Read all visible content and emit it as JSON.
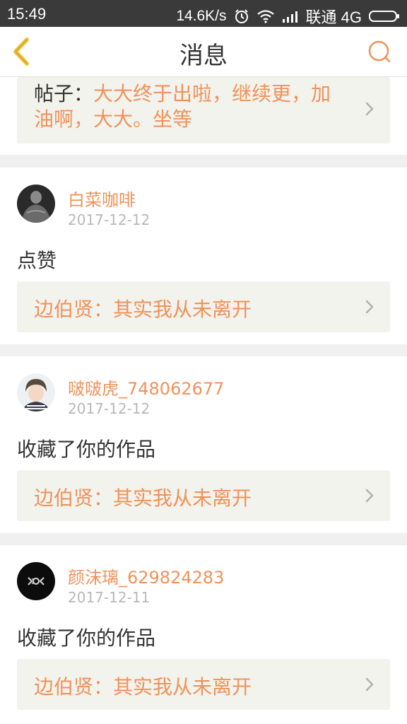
{
  "status": {
    "time": "15:49",
    "speed": "14.6K/s",
    "carrier": "联通 4G"
  },
  "header": {
    "title": "消息"
  },
  "top_post": {
    "label": "帖子：",
    "text": "大大终于出啦，继续更，加",
    "text_line2": "油啊，大大。坐等"
  },
  "messages": [
    {
      "user": "白菜咖啡",
      "date": "2017-12-12",
      "action": "点赞",
      "work": "边伯贤：其实我从未离开"
    },
    {
      "user": "啵啵虎_748062677",
      "date": "2017-12-12",
      "action": "收藏了你的作品",
      "work": "边伯贤：其实我从未离开"
    },
    {
      "user": "颜沫璃_629824283",
      "date": "2017-12-11",
      "action": "收藏了你的作品",
      "work": "边伯贤：其实我从未离开"
    }
  ],
  "colors": {
    "accent": "#f0925a",
    "back_arrow": "#f2c33a",
    "status_bar": "#3a3a3a",
    "link_bg": "#f3f3ed"
  },
  "icons": [
    "back-arrow-icon",
    "search-icon",
    "chevron-right-icon",
    "alarm-icon",
    "wifi-icon",
    "signal-icon",
    "battery-icon"
  ]
}
